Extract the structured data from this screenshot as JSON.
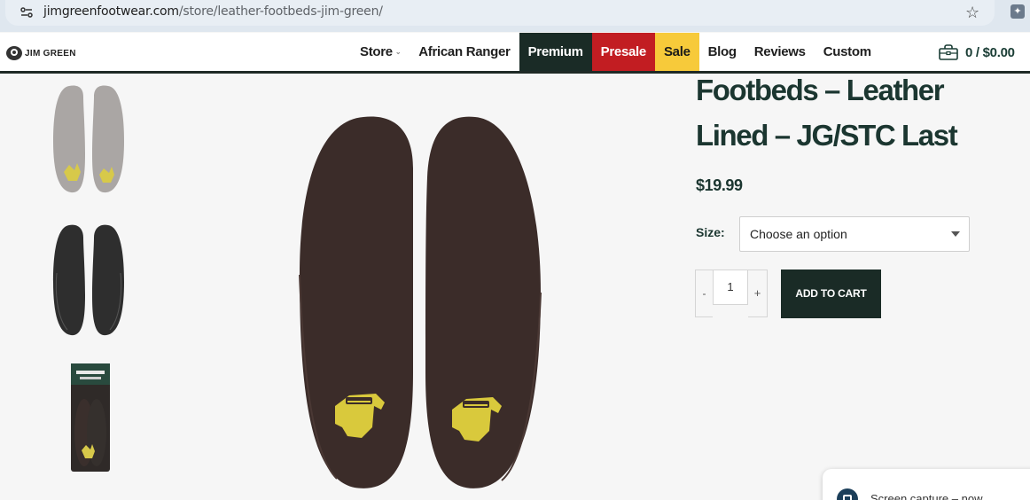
{
  "browser": {
    "url_domain": "jimgreenfootwear.com",
    "url_path": "/store/leather-footbeds-jim-green/"
  },
  "header": {
    "logo_text": "JIM GREEN",
    "nav": [
      {
        "label": "Store"
      },
      {
        "label": "African Ranger"
      },
      {
        "label": "Premium"
      },
      {
        "label": "Presale"
      },
      {
        "label": "Sale"
      },
      {
        "label": "Blog"
      },
      {
        "label": "Reviews"
      },
      {
        "label": "Custom"
      }
    ],
    "cart_text": "0 / $0.00"
  },
  "product": {
    "title": "Footbeds – Leather Lined – JG/STC Last",
    "price": "$19.99",
    "size_label": "Size:",
    "size_placeholder": "Choose an option",
    "qty_minus": "-",
    "qty_value": "1",
    "qty_plus": "+",
    "add_to_cart": "ADD TO CART"
  },
  "toast": {
    "text": "Screen capture – now"
  },
  "colors": {
    "brand_dark": "#1a2b26",
    "presale": "#c21d22",
    "sale": "#f7ca3a",
    "title_green": "#1b3630"
  }
}
